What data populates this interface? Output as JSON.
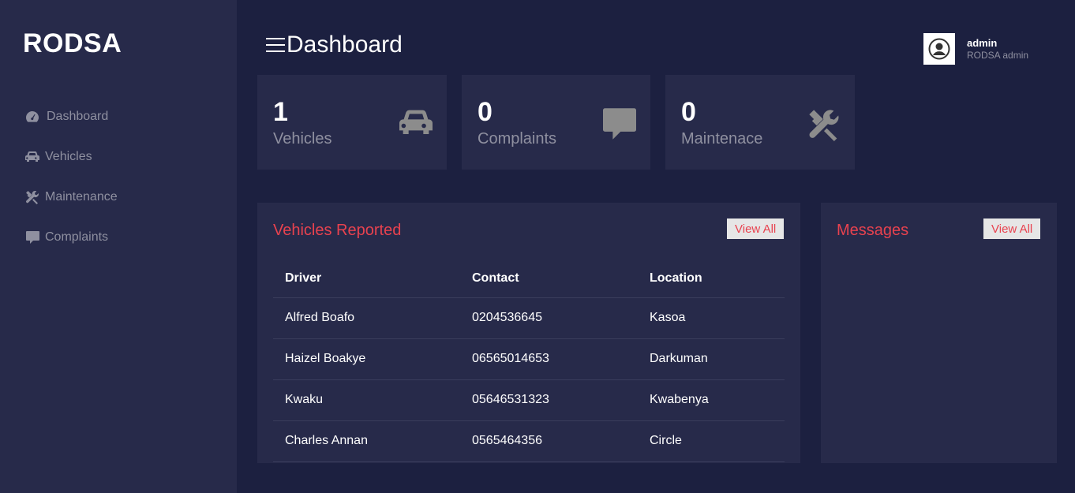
{
  "app": {
    "brand": "RODSA"
  },
  "sidebar": {
    "items": [
      {
        "label": "Dashboard",
        "icon": "gauge-icon"
      },
      {
        "label": "Vehicles",
        "icon": "car-icon"
      },
      {
        "label": "Maintenance",
        "icon": "tools-icon"
      },
      {
        "label": "Complaints",
        "icon": "comment-icon"
      }
    ]
  },
  "header": {
    "title": "Dashboard"
  },
  "user": {
    "name": "admin",
    "role": "RODSA admin"
  },
  "stats": [
    {
      "value": "1",
      "label": "Vehicles",
      "icon": "car-icon"
    },
    {
      "value": "0",
      "label": "Complaints",
      "icon": "comment-icon"
    },
    {
      "value": "0",
      "label": "Maintenace",
      "icon": "tools-icon"
    }
  ],
  "vehicles_panel": {
    "title": "Vehicles Reported",
    "view_all": "View All",
    "columns": [
      "Driver",
      "Contact",
      "Location"
    ],
    "rows": [
      [
        "Alfred Boafo",
        "0204536645",
        "Kasoa"
      ],
      [
        "Haizel Boakye",
        "06565014653",
        "Darkuman"
      ],
      [
        "Kwaku",
        "05646531323",
        "Kwabenya"
      ],
      [
        "Charles Annan",
        "0565464356",
        "Circle"
      ]
    ]
  },
  "messages_panel": {
    "title": "Messages",
    "view_all": "View All"
  },
  "colors": {
    "background": "#1c2040",
    "panel": "#272a4a",
    "accent": "#e8424f",
    "muted": "#8f90a0"
  }
}
